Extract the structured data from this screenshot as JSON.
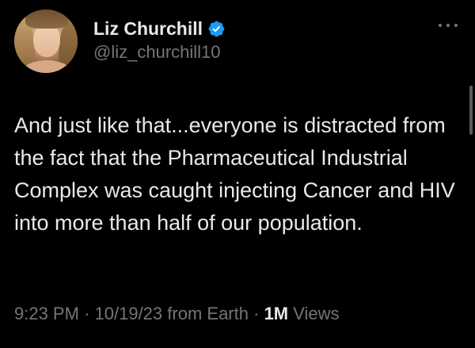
{
  "author": {
    "display_name": "Liz Churchill",
    "handle": "@liz_churchill10",
    "verified": true,
    "verified_badge_color": "#1d9bf0"
  },
  "tweet": {
    "text": "And just like that...everyone is distracted from the fact that the Pharmaceutical Industrial Complex was caught injecting Cancer and HIV into more than half of our population.",
    "time": "9:23 PM",
    "date": "10/19/23",
    "source": "from Earth",
    "separator": "·",
    "views_count": "1M",
    "views_label": "Views"
  },
  "icons": {
    "more": "more-horizontal-icon",
    "verified": "verified-badge-icon"
  },
  "colors": {
    "background": "#000000",
    "primary_text": "#e7e9ea",
    "secondary_text": "#71767b"
  }
}
